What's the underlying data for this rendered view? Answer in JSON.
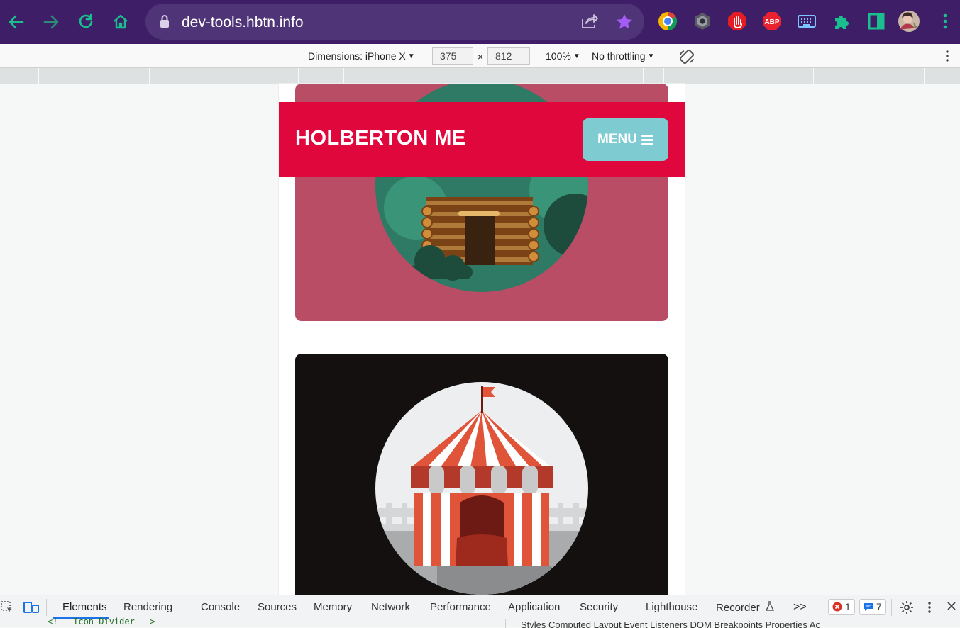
{
  "browser": {
    "url": "dev-tools.hbtn.info",
    "colors": {
      "bar": "#3e1f67",
      "omnibox": "#4f3577",
      "nav": "#1bbf8f"
    },
    "icons": [
      "back-arrow-icon",
      "forward-arrow-icon",
      "reload-icon",
      "home-icon",
      "lock-icon",
      "share-icon",
      "bookmark-star-icon",
      "kebab-menu-icon"
    ],
    "extensions": [
      {
        "name": "chrome-extension-colorful-icon"
      },
      {
        "name": "extension-dark-hex-icon"
      },
      {
        "name": "stop-hand-extension-icon"
      },
      {
        "name": "adblock-plus-icon",
        "label": "ABP"
      },
      {
        "name": "keyboard-extension-icon"
      },
      {
        "name": "puzzle-extensions-icon"
      },
      {
        "name": "side-panel-icon"
      },
      {
        "name": "profile-avatar"
      }
    ]
  },
  "device_toolbar": {
    "dimensions_label": "Dimensions: iPhone X",
    "width": "375",
    "times": "×",
    "height": "812",
    "zoom": "100%",
    "throttling": "No throttling"
  },
  "site": {
    "title": "HOLBERTON ME",
    "menu_label": "MENU",
    "colors": {
      "header": "#e0073d",
      "menu": "#7ecbd2",
      "card1": "#b94d65",
      "card2": "#141010"
    }
  },
  "devtools": {
    "tabs": [
      "Elements",
      "Rendering",
      "Console",
      "Sources",
      "Memory",
      "Network",
      "Performance",
      "Application",
      "Security",
      "Lighthouse",
      "Recorder"
    ],
    "active_tab": "Elements",
    "more": ">>",
    "error_count": "1",
    "message_count": "7",
    "code_snippet": "<!-- Icon Divider -->",
    "styles_tabs": "Styles    Computed    Layout    Event Listeners    DOM Breakpoints    Properties    Ac"
  }
}
